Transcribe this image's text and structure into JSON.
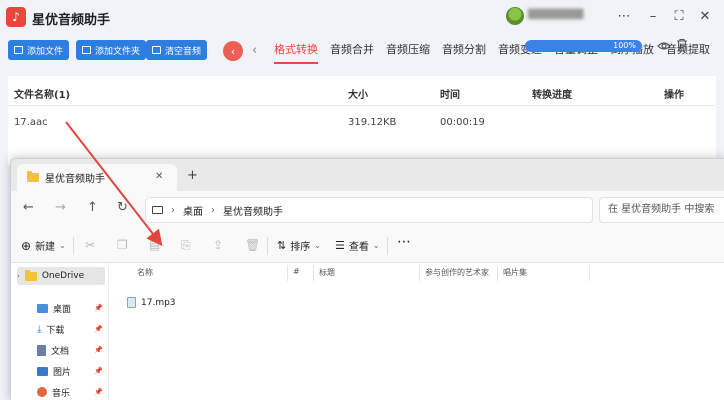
{
  "app": {
    "title": "星优音频助手",
    "logo_glyph": "♪",
    "window_buttons": [
      "⋯",
      "–",
      "⛶",
      "✕"
    ]
  },
  "toolbar": {
    "add_file": "添加文件",
    "add_folder": "添加文件夹",
    "clear": "清空音频"
  },
  "tabs": [
    "格式转换",
    "音频合并",
    "音频压缩",
    "音频分割",
    "音频变速",
    "音量调整",
    "倒序播放",
    "音频提取"
  ],
  "active_tab": "格式转换",
  "table": {
    "headers": {
      "name": "文件名称(1)",
      "size": "大小",
      "time": "时间",
      "progress": "转换进度",
      "action": "操作"
    },
    "rows": [
      {
        "name": "17.aac",
        "size": "319.12KB",
        "time": "00:00:19",
        "progress_label": "100%",
        "progress": 1.0
      }
    ]
  },
  "explorer": {
    "tab_title": "星优音频助手",
    "breadcrumb": [
      "桌面",
      "星优音频助手"
    ],
    "search_placeholder": "在 星优音频助手 中搜索",
    "commands": {
      "new": "新建",
      "sort": "排序",
      "view": "查看"
    },
    "nav_pane": [
      {
        "label": "OneDrive",
        "selected": true
      },
      {
        "label": "桌面"
      },
      {
        "label": "下载"
      },
      {
        "label": "文档"
      },
      {
        "label": "图片"
      },
      {
        "label": "音乐"
      }
    ],
    "columns": [
      "名称",
      "#",
      "标题",
      "参与创作的艺术家",
      "唱片集"
    ],
    "files": [
      "17.mp3"
    ]
  },
  "colors": {
    "accent_blue": "#2e7de1",
    "accent_red": "#e8473d",
    "arrow": "#e0483e"
  }
}
